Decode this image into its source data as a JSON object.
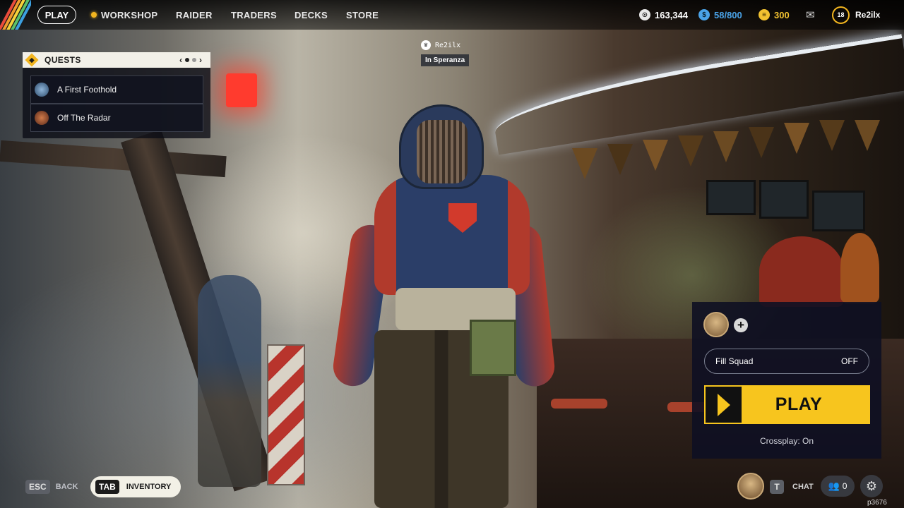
{
  "nav": {
    "play": "PLAY",
    "workshop": "WORKSHOP",
    "raider": "RAIDER",
    "traders": "TRADERS",
    "decks": "DECKS",
    "store": "STORE"
  },
  "currency": {
    "coins": "163,344",
    "storage": "58/800",
    "tokens": "300",
    "level": "18",
    "username": "Re2ilx"
  },
  "quests": {
    "title": "QUESTS",
    "page": 1,
    "pages": 3,
    "items": [
      {
        "name": "A First Foothold"
      },
      {
        "name": "Off The Radar"
      }
    ]
  },
  "player_tag": {
    "name": "Re2ilx",
    "location": "In Speranza"
  },
  "squad": {
    "fill_squad_label": "Fill Squad",
    "fill_squad_value": "OFF",
    "play_label": "PLAY",
    "crossplay": "Crossplay: On"
  },
  "bottom": {
    "back_key": "ESC",
    "back_label": "BACK",
    "inventory_key": "TAB",
    "inventory_label": "INVENTORY",
    "chat_key": "T",
    "chat_label": "CHAT",
    "friends_count": "0",
    "build_id": "p3676"
  },
  "colors": {
    "accent": "#f7c51e",
    "panel": "#0e1022"
  }
}
